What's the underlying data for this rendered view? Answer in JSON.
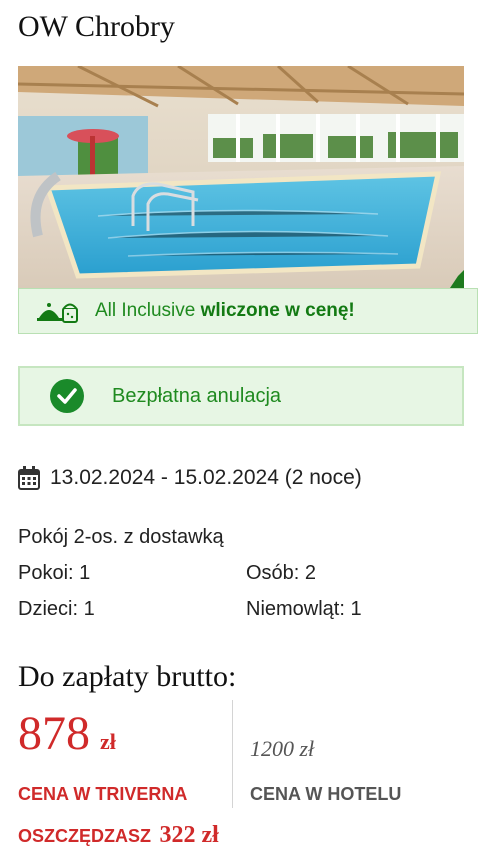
{
  "hotel": {
    "name": "OW Chrobry"
  },
  "all_inclusive": {
    "prefix": "All Inclusive",
    "emphasis": "wliczone w cenę!",
    "icon": "food-tray-icon"
  },
  "cancellation": {
    "label": "Bezpłatna anulacja",
    "icon": "check-circle-icon"
  },
  "stay": {
    "dates": "13.02.2024 - 15.02.2024 (2 noce)",
    "icon": "calendar-icon"
  },
  "room": {
    "type": "Pokój 2-os. z dostawką",
    "rooms": "Pokoi: 1",
    "persons": "Osób: 2",
    "children": "Dzieci: 1",
    "infants": "Niemowląt: 1"
  },
  "payment": {
    "title": "Do zapłaty brutto:",
    "price": "878",
    "currency": "zł",
    "price_label": "CENA W TRIVERNA",
    "hotel_price": "1200 zł",
    "hotel_price_label": "CENA W HOTELU",
    "savings_label": "OSZCZĘDZASZ",
    "savings_amount": "322 zł"
  },
  "colors": {
    "accent_red": "#d02a2a",
    "green": "#1f8a1f",
    "green_bg": "#e7f6e4"
  }
}
